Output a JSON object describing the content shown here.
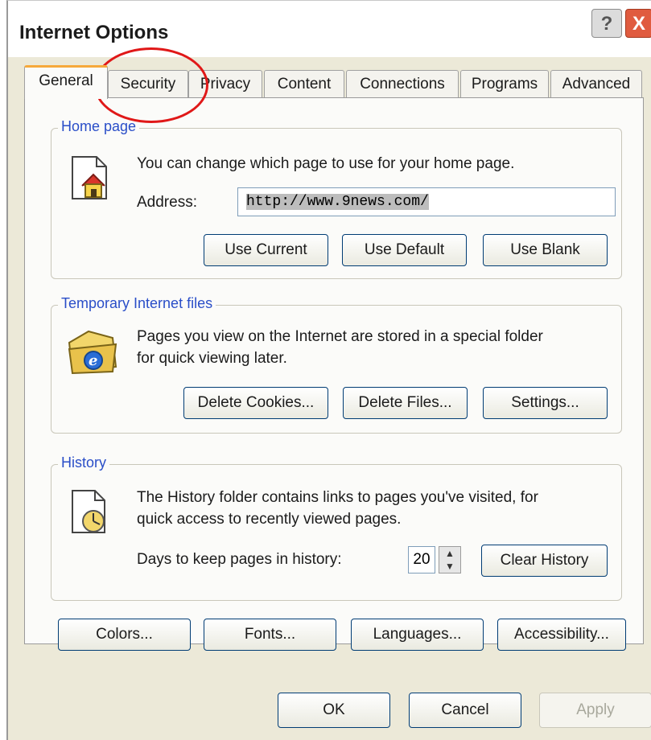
{
  "window": {
    "title": "Internet Options",
    "help_glyph": "?",
    "close_glyph": "X"
  },
  "tabs": [
    {
      "label": "General",
      "active": true
    },
    {
      "label": "Security",
      "active": false
    },
    {
      "label": "Privacy",
      "active": false
    },
    {
      "label": "Content",
      "active": false
    },
    {
      "label": "Connections",
      "active": false
    },
    {
      "label": "Programs",
      "active": false
    },
    {
      "label": "Advanced",
      "active": false
    }
  ],
  "home_page": {
    "legend": "Home page",
    "description": "You can change which page to use for your home page.",
    "address_label": "Address:",
    "address_value": "http://www.9news.com/",
    "use_current": "Use Current",
    "use_default": "Use Default",
    "use_blank": "Use Blank",
    "icon": "home-page-icon"
  },
  "temp_files": {
    "legend": "Temporary Internet files",
    "description_line1": "Pages you view on the Internet are stored in a special folder",
    "description_line2": "for quick viewing later.",
    "delete_cookies": "Delete Cookies...",
    "delete_files": "Delete Files...",
    "settings": "Settings...",
    "icon": "ie-folder-icon"
  },
  "history": {
    "legend": "History",
    "description_line1": "The History folder contains links to pages you've visited, for",
    "description_line2": "quick access to recently viewed pages.",
    "days_label": "Days to keep pages in history:",
    "days_value": "20",
    "clear_history": "Clear History",
    "icon": "history-icon"
  },
  "bottom_buttons": {
    "colors": "Colors...",
    "fonts": "Fonts...",
    "languages": "Languages...",
    "accessibility": "Accessibility..."
  },
  "dialog_buttons": {
    "ok": "OK",
    "cancel": "Cancel",
    "apply": "Apply"
  },
  "annotation": {
    "circle_color": "#e01818",
    "target": "Security"
  },
  "colors": {
    "legend_text": "#2a4ec8",
    "active_tab_accent": "#f6a93b",
    "button_border": "#003c74",
    "dialog_bg": "#ece9d8"
  }
}
